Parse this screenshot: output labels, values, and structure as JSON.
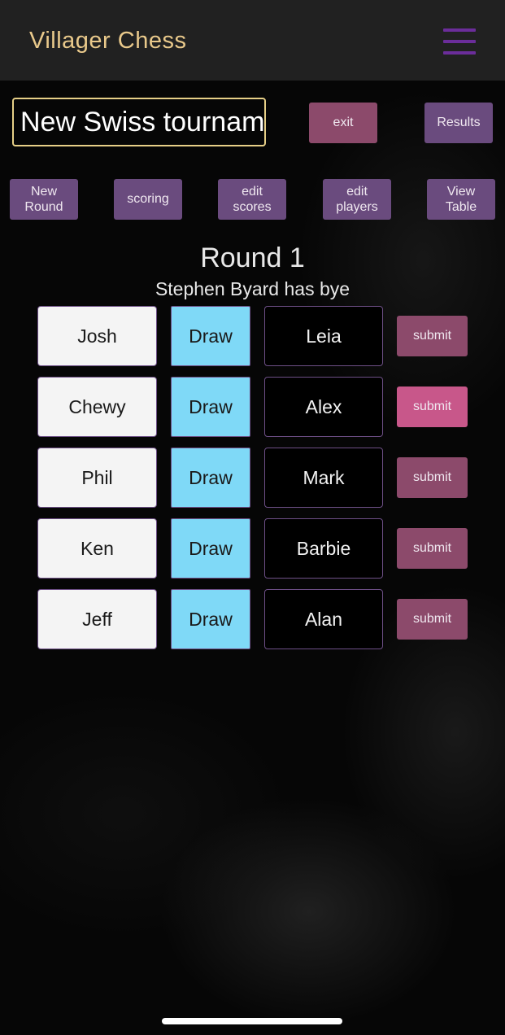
{
  "header": {
    "title": "Villager Chess",
    "menu_icon": "hamburger-menu-icon",
    "title_color": "#e9c98b",
    "menu_color": "#6b2d9a"
  },
  "tournament": {
    "name_value": "New Swiss tournam",
    "exit_label": "exit",
    "results_label": "Results"
  },
  "actions": {
    "new_round": "New\nRound",
    "scoring": "scoring",
    "edit_scores": "edit\nscores",
    "edit_players": "edit\nplayers",
    "view_table": "View\nTable"
  },
  "round": {
    "title": "Round 1",
    "bye": "Stephen Byard has bye",
    "pairings": [
      {
        "white": "Josh",
        "draw": "Draw",
        "black": "Leia",
        "submit": "submit",
        "submit_active": false
      },
      {
        "white": "Chewy",
        "draw": "Draw",
        "black": "Alex",
        "submit": "submit",
        "submit_active": true
      },
      {
        "white": "Phil",
        "draw": "Draw",
        "black": "Mark",
        "submit": "submit",
        "submit_active": false
      },
      {
        "white": "Ken",
        "draw": "Draw",
        "black": "Barbie",
        "submit": "submit",
        "submit_active": false
      },
      {
        "white": "Jeff",
        "draw": "Draw",
        "black": "Alan",
        "submit": "submit",
        "submit_active": false
      }
    ]
  },
  "colors": {
    "accent_purple": "#6a4b7e",
    "submit_mauve": "#8c4a6b",
    "submit_active": "#c8578a",
    "draw_blue": "#7fd9f7",
    "input_border": "#e6cf87"
  }
}
